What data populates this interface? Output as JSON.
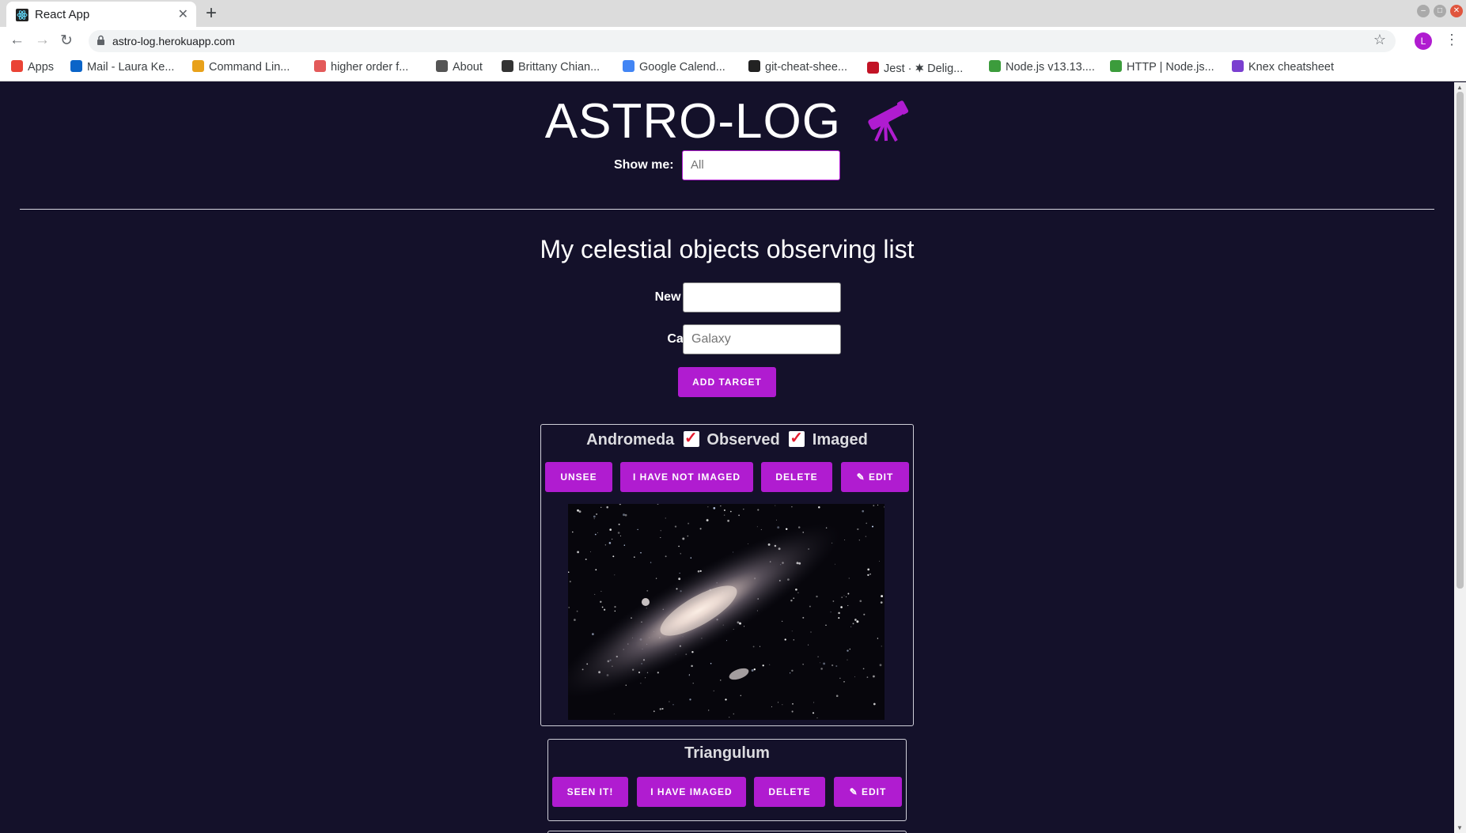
{
  "browser": {
    "tab_title": "React App",
    "url": "astro-log.herokuapp.com",
    "profile_initial": "L",
    "bookmarks": [
      {
        "label": "Apps",
        "color": "#ea4335"
      },
      {
        "label": "Mail - Laura Ke...",
        "color": "#0a64c8"
      },
      {
        "label": "Command Lin...",
        "color": "#e8a11a"
      },
      {
        "label": "higher order f...",
        "color": "#e35a5a"
      },
      {
        "label": "About",
        "color": "#555555"
      },
      {
        "label": "Brittany Chian...",
        "color": "#333333"
      },
      {
        "label": "Google Calend...",
        "color": "#4285f4"
      },
      {
        "label": "git-cheat-shee...",
        "color": "#222222"
      },
      {
        "label": "Jest · 🟋 Delig...",
        "color": "#c21325"
      },
      {
        "label": "Node.js v13.13....",
        "color": "#3c9c3c"
      },
      {
        "label": "HTTP | Node.js...",
        "color": "#3c9c3c"
      },
      {
        "label": "Knex cheatsheet",
        "color": "#7a3fd0"
      }
    ]
  },
  "app": {
    "title": "ASTRO-LOG",
    "filter": {
      "label": "Show me:",
      "placeholder": "All"
    },
    "heading": "My celestial objects observing list",
    "form": {
      "new_target_label": "New Target:",
      "new_target_value": "",
      "category_label": "Category:",
      "category_placeholder": "Galaxy",
      "add_button": "ADD TARGET"
    },
    "targets": [
      {
        "name": "Andromeda",
        "observed_label": "Observed",
        "imaged_label": "Imaged",
        "observed": true,
        "imaged": true,
        "buttons": [
          "UNSEE",
          "I HAVE NOT IMAGED",
          "DELETE",
          "✎ EDIT"
        ]
      },
      {
        "name": "Triangulum",
        "observed": false,
        "imaged": false,
        "buttons": [
          "SEEN IT!",
          "I HAVE IMAGED",
          "DELETE",
          "✎ EDIT"
        ]
      }
    ]
  },
  "colors": {
    "background": "#14112a",
    "accent": "#b01cd0",
    "check": "#e31b2e"
  }
}
